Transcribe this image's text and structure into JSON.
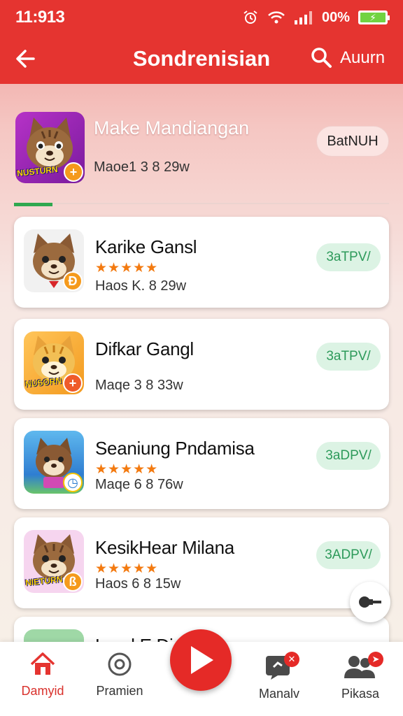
{
  "status_bar": {
    "time": "11:913",
    "battery": "00%"
  },
  "header": {
    "title": "Sondrenisian",
    "account_label": "Auurn",
    "back_icon": "arrow-left-icon",
    "search_icon": "search-icon"
  },
  "featured": {
    "title": "Make Mandiangan",
    "meta": "Maoe1 3 8 29w",
    "button_label": "BatNUH",
    "icon_text": "NUSTURN",
    "icon_badge": "+"
  },
  "apps": [
    {
      "name": "Karike Gansl",
      "stars": "★★★★★",
      "meta": "Haos K. 8 29w",
      "button_label": "3aTPV/",
      "icon_badge": "Ð"
    },
    {
      "name": "Difkar Gangl",
      "meta": "Maqe 3 8 33w",
      "button_label": "3aTPV/",
      "icon_text": "NUSORN",
      "icon_badge": "+"
    },
    {
      "name": "Seaniung Pndamisa",
      "stars": "★★★★★",
      "meta": "Maqe 6 8 76w",
      "button_label": "3aDPV/",
      "icon_badge": "◷"
    },
    {
      "name": "KesikHear Milana",
      "stars": "★★★★★",
      "meta": "Haos 6 8 15w",
      "button_label": "3ADPV/",
      "icon_text": "NIETURN",
      "icon_badge": "ß"
    },
    {
      "name": "Land E Di"
    }
  ],
  "colors": {
    "brand_red": "#e53430",
    "install_green": "#2d9a5a",
    "star_orange": "#f37a10"
  },
  "bottom_nav": {
    "items": [
      {
        "label": "Damyid",
        "icon": "home-icon"
      },
      {
        "label": "Pramien",
        "icon": "disc-icon"
      },
      {
        "label": "Manalv",
        "icon": "chat-icon",
        "badge": "✕"
      },
      {
        "label": "Pikasa",
        "icon": "people-icon",
        "badge": "➤"
      }
    ],
    "center_icon": "play-icon"
  }
}
